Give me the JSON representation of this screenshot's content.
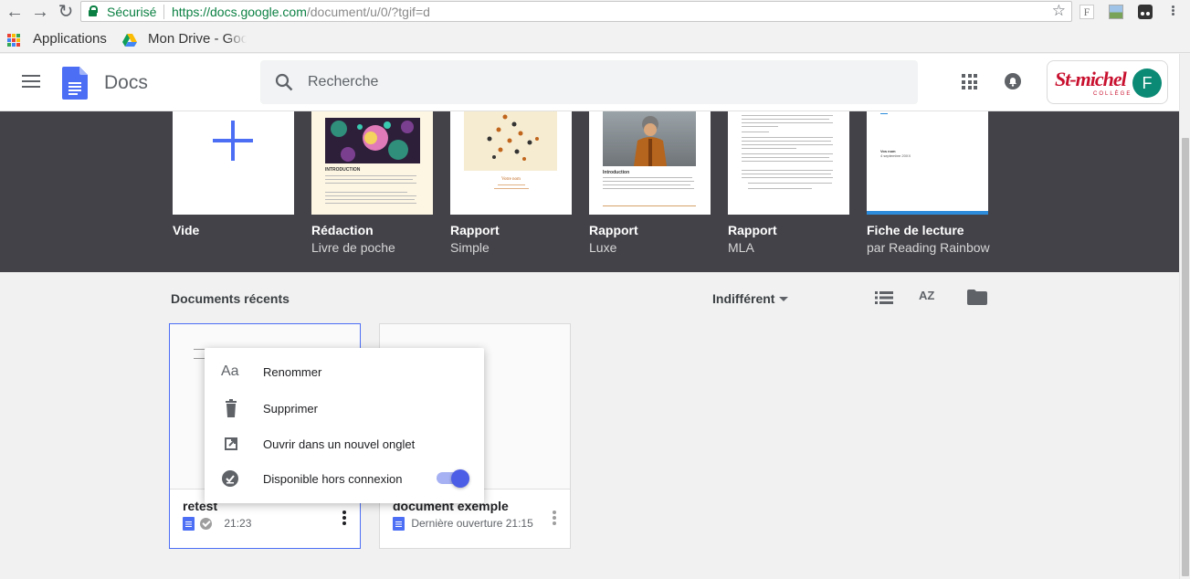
{
  "browser": {
    "secure_label": "Sécurisé",
    "url_host": "https://docs.google.com",
    "url_path": "/document/u/0/?tgif=d",
    "bookmarks": [
      {
        "label": "Applications",
        "icon": "apps-grid-icon"
      },
      {
        "label": "Mon Drive - Google Drive",
        "icon": "google-drive-icon"
      }
    ],
    "extension_f_label": "F"
  },
  "header": {
    "app_name": "Docs",
    "search_placeholder": "Recherche",
    "account_logo_text": "St-michel",
    "account_logo_sub": "COLLÈGE",
    "avatar_letter": "F"
  },
  "templates": [
    {
      "name": "Vide",
      "sub": ""
    },
    {
      "name": "Rédaction",
      "sub": "Livre de poche"
    },
    {
      "name": "Rapport",
      "sub": "Simple"
    },
    {
      "name": "Rapport",
      "sub": "Luxe"
    },
    {
      "name": "Rapport",
      "sub": "MLA"
    },
    {
      "name": "Fiche de lecture",
      "sub": "par Reading Rainbow"
    }
  ],
  "template_thumbs": {
    "redaction_heading": "INTRODUCTION",
    "rapport_simple_title": "Votre nom",
    "rapport_luxe_heading": "Introduction",
    "fiche_name": "Vos nom",
    "fiche_date": "4 septembre 20XX"
  },
  "recent": {
    "title": "Documents récents",
    "owner_filter": "Indifférent",
    "sort_label": "AZ"
  },
  "documents": [
    {
      "title": "retest",
      "meta": "21:23",
      "offline": true
    },
    {
      "title": "document exemple",
      "meta": "Dernière ouverture  21:15",
      "offline": false
    }
  ],
  "context_menu": {
    "items": [
      {
        "label": "Renommer",
        "icon": "text-format-icon"
      },
      {
        "label": "Supprimer",
        "icon": "trash-icon"
      },
      {
        "label": "Ouvrir dans un nouvel onglet",
        "icon": "open-in-new-icon"
      },
      {
        "label": "Disponible hors connexion",
        "icon": "offline-check-icon"
      }
    ],
    "offline_toggle_on": true,
    "rename_icon_text": "Aa"
  },
  "colors": {
    "accent": "#4c5de6",
    "band": "#434249",
    "secure_green": "#0b8043",
    "avatar": "#0b8a75"
  }
}
